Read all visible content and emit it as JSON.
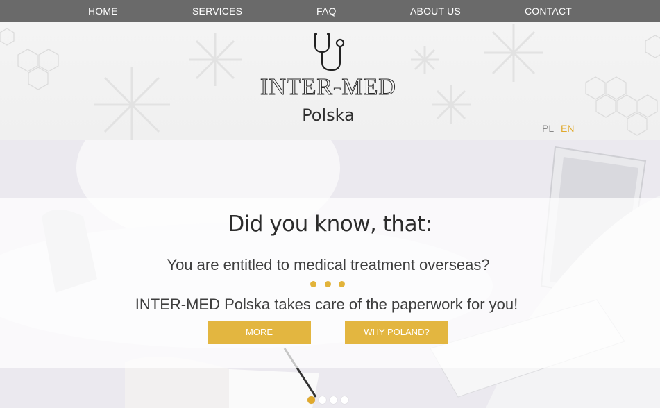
{
  "nav": {
    "items": [
      "HOME",
      "SERVICES",
      "FAQ",
      "ABOUT US",
      "CONTACT"
    ]
  },
  "header": {
    "logo_title": "INTER-MED",
    "logo_subtitle": "Polska",
    "logo_icon": "stethoscope-icon",
    "languages": [
      "PL",
      "EN"
    ],
    "active_language": "EN"
  },
  "hero": {
    "heading": "Did you know, that:",
    "line1": "You are entitled to medical treatment overseas?",
    "line2": "INTER-MED Polska takes care of the paperwork for you!",
    "buttons": {
      "more": "MORE",
      "why_poland": "WHY POLAND?"
    },
    "slides_total": 4,
    "active_slide": 1
  },
  "colors": {
    "nav_bg": "#6a6a6a",
    "accent": "#e3b640",
    "active_lang": "#e0a92c"
  }
}
